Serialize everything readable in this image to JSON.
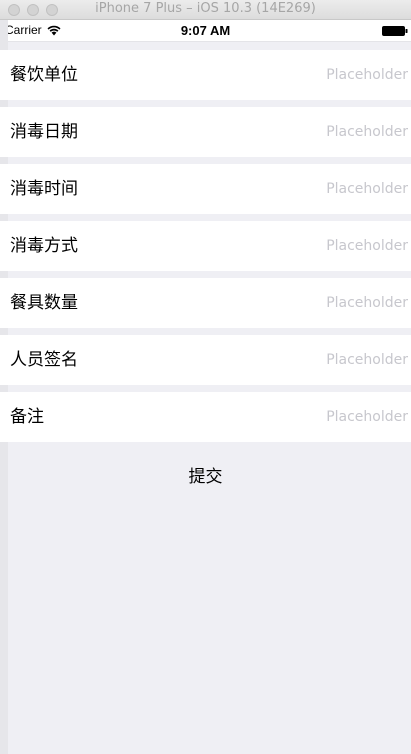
{
  "window": {
    "title": "iPhone 7 Plus – iOS 10.3 (14E269)"
  },
  "status_bar": {
    "carrier": "Carrier",
    "time": "9:07 AM",
    "wifi_icon": "wifi-icon",
    "battery_icon": "battery-icon"
  },
  "form": {
    "rows": [
      {
        "label": "餐饮单位",
        "placeholder": "Placeholder"
      },
      {
        "label": "消毒日期",
        "placeholder": "Placeholder"
      },
      {
        "label": "消毒时间",
        "placeholder": "Placeholder"
      },
      {
        "label": "消毒方式",
        "placeholder": "Placeholder"
      },
      {
        "label": "餐具数量",
        "placeholder": "Placeholder"
      },
      {
        "label": "人员签名",
        "placeholder": "Placeholder"
      },
      {
        "label": "备注",
        "placeholder": "Placeholder"
      }
    ],
    "submit_label": "提交"
  },
  "colors": {
    "background": "#efeff4",
    "row_background": "#ffffff",
    "placeholder": "#c7c7cd",
    "text": "#000000"
  }
}
